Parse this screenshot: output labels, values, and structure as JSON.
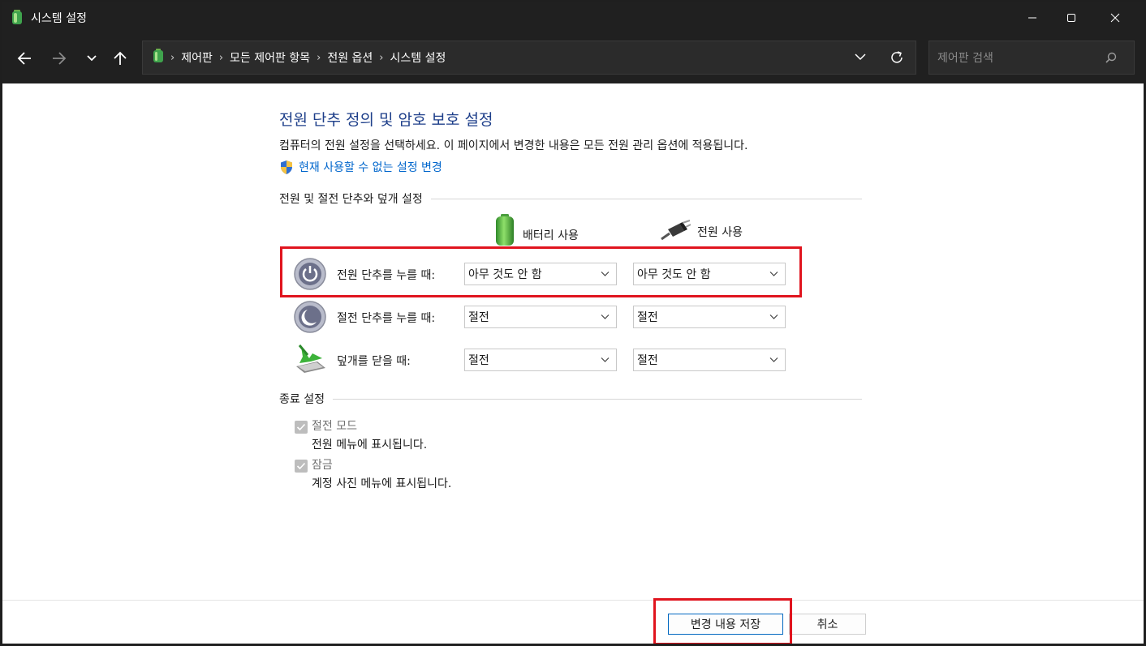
{
  "window": {
    "title": "시스템 설정"
  },
  "address": {
    "crumbs": [
      "제어판",
      "모든 제어판 항목",
      "전원 옵션",
      "시스템 설정"
    ]
  },
  "search": {
    "placeholder": "제어판 검색"
  },
  "content": {
    "heading": "전원 단추 정의 및 암호 보호 설정",
    "description": "컴퓨터의 전원 설정을 선택하세요. 이 페이지에서 변경한 내용은 모든 전원 관리 옵션에 적용됩니다.",
    "link": "현재 사용할 수 없는 설정 변경",
    "section1": "전원 및 절전 단추와 덮개 설정",
    "columns": {
      "battery": "배터리 사용",
      "plugged": "전원 사용"
    },
    "rows": [
      {
        "label": "전원 단추를 누를 때:",
        "battery": "아무 것도 안 함",
        "plugged": "아무 것도 안 함"
      },
      {
        "label": "절전 단추를 누를 때:",
        "battery": "절전",
        "plugged": "절전"
      },
      {
        "label": "덮개를 닫을 때:",
        "battery": "절전",
        "plugged": "절전"
      }
    ],
    "section2": "종료 설정",
    "shutdown": [
      {
        "label": "절전 모드",
        "desc": "전원 메뉴에 표시됩니다.",
        "checked": true
      },
      {
        "label": "잠금",
        "desc": "계정 사진 메뉴에 표시됩니다.",
        "checked": true
      }
    ]
  },
  "buttons": {
    "save": "변경 내용 저장",
    "cancel": "취소"
  },
  "colors": {
    "highlight": "#e0141e",
    "heading": "#1e3f8a",
    "link": "#0066cc"
  }
}
